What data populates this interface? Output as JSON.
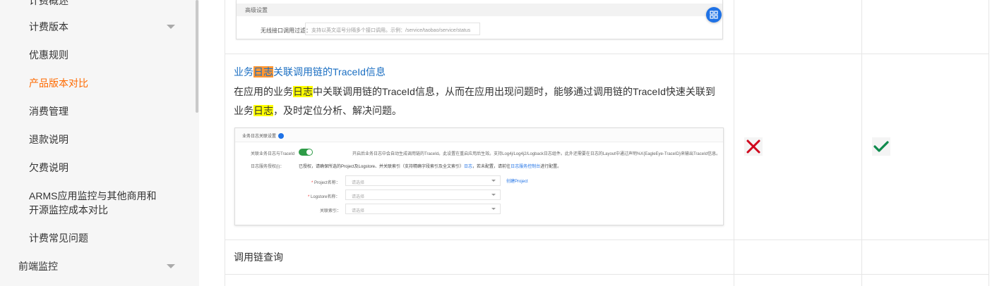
{
  "sidebar": {
    "partial_top": "计费概述",
    "items": [
      {
        "label": "计费版本",
        "has_chevron": true
      },
      {
        "label": "优惠规则"
      },
      {
        "label": "产品版本对比",
        "active": true
      },
      {
        "label": "消费管理"
      },
      {
        "label": "退款说明"
      },
      {
        "label": "欠费说明"
      },
      {
        "label": "ARMS应用监控与其他商用和",
        "label2": "开源监控成本对比"
      },
      {
        "label": "计费常见问题"
      }
    ],
    "section": {
      "label": "前端监控",
      "has_chevron": true
    }
  },
  "top_image": {
    "bar_label": "高级设置",
    "field_label": "无线接口调用过滤：",
    "field_placeholder": "支持以英文逗号分隔多个接口调用。示例：/service/taobao/service/status"
  },
  "feature": {
    "title_pre": "业务",
    "title_hl": "日志",
    "title_post": "关联调用链的TraceId信息",
    "desc_1": "在应用的业务",
    "desc_hl1": "日志",
    "desc_2": "中关联调用链的TraceId信息，从而在应用出现问题时，能够通过调用链的TraceId快速关联到",
    "desc_3": "业务",
    "desc_hl2": "日志",
    "desc_4": "，及时定位分析、解决问题。"
  },
  "settings_image": {
    "header": "业务日志关联设置",
    "toggle_label": "关联业务日志与TraceId",
    "toggle_desc": "开启后业务日志中会自动生成调用链的TraceId。此设置在重启应用后生效。支持Log4j/Log4j2/Logback日志组件。此外还需要在日志的Layout中通过声明%X{EagleEye-TraceID}来输出TraceId信息。",
    "sls_label": "日志服务授权(i)：",
    "sls_desc": "已授权，请确保所选的Project及Logstore、并关联索引（支持精确字段索引及全文索引）",
    "sls_link1": "日志",
    "sls_mid": "，若未配置，请前往",
    "sls_link2": "日志服务控制台",
    "sls_end": "进行配置。",
    "project_label": "Project名称：",
    "logstore_label": "Logstore名称：",
    "index_label": "关联索引：",
    "select_placeholder": "请选择",
    "create_project": "创建Project"
  },
  "comparison": {
    "col1": {
      "status": "unsupported",
      "icon": "cross-icon",
      "color": "#d0021b"
    },
    "col2": {
      "status": "supported",
      "icon": "check-icon",
      "color": "#0e8a4c"
    }
  },
  "next_row": {
    "label": "调用链查询"
  },
  "colors": {
    "active_nav": "#ff6a00",
    "link": "#1a6ec2",
    "highlight": "#ffff00",
    "highlight_current": "#ff9632",
    "fab": "#1f72e6"
  }
}
